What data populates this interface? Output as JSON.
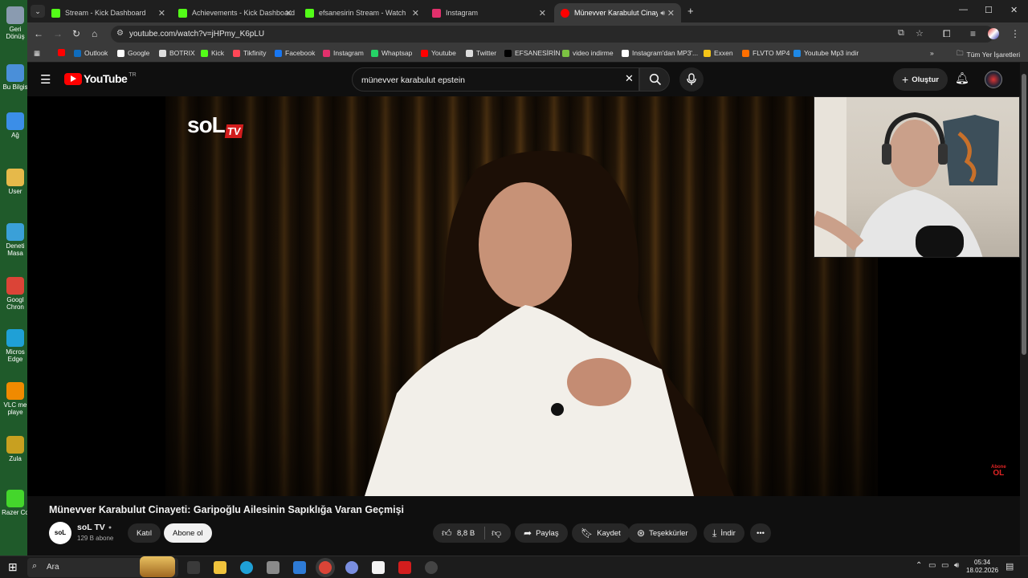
{
  "desktop": {
    "items": [
      {
        "label": "Geri\nDönüş",
        "color": "#8a9bb0"
      },
      {
        "label": "Bu Bilgis",
        "color": "#4a8fd9"
      },
      {
        "label": "Ağ",
        "color": "#3b8ee8"
      },
      {
        "label": "User",
        "color": "#e6b94a"
      },
      {
        "label": "Deneti\nMasa",
        "color": "#3aa0d8"
      },
      {
        "label": "Googl\nChron",
        "color": "#db4437"
      },
      {
        "label": "Micros\nEdge",
        "color": "#1fa0d6"
      },
      {
        "label": "VLC me\nplaye",
        "color": "#f08a00"
      },
      {
        "label": "Zula",
        "color": "#c8a020"
      },
      {
        "label": "Razer Co",
        "color": "#44d62c"
      }
    ]
  },
  "browser": {
    "tabs": [
      {
        "label": "Stream - Kick Dashboard",
        "color": "#53fc18"
      },
      {
        "label": "Achievements - Kick Dashboard",
        "color": "#53fc18"
      },
      {
        "label": "efsanesirin Stream - Watch Live",
        "color": "#53fc18"
      },
      {
        "label": "Instagram",
        "color": "#e1306c"
      },
      {
        "label": "Münevver Karabulut Cinaye",
        "color": "#ff0000"
      }
    ],
    "new_tab": "+",
    "url": "youtube.com/watch?v=jHPmy_K6pLU",
    "bookmarks": [
      {
        "label": "",
        "color": "#ff0000"
      },
      {
        "label": "Outlook",
        "color": "#0f6cbd"
      },
      {
        "label": "Google",
        "color": "#ffffff"
      },
      {
        "label": "BOTRIX",
        "color": "#dddddd"
      },
      {
        "label": "Kick",
        "color": "#53fc18"
      },
      {
        "label": "Tikfinity",
        "color": "#ff4757"
      },
      {
        "label": "Facebook",
        "color": "#1877f2"
      },
      {
        "label": "Instagram",
        "color": "#e1306c"
      },
      {
        "label": "Whaptsap",
        "color": "#25d366"
      },
      {
        "label": "Youtube",
        "color": "#ff0000"
      },
      {
        "label": "Twitter",
        "color": "#dddddd"
      },
      {
        "label": "EFSANESİRİN",
        "color": "#000000"
      },
      {
        "label": "video indirme",
        "color": "#7cc242"
      },
      {
        "label": "Instagram'dan MP3'...",
        "color": "#ffffff"
      },
      {
        "label": "Exxen",
        "color": "#f5c518"
      },
      {
        "label": "FLVTO MP4",
        "color": "#ff6f00"
      },
      {
        "label": "Youtube Mp3 indir",
        "color": "#1e88e5"
      }
    ],
    "all_bookmarks": "Tüm Yer İşaretleri"
  },
  "youtube": {
    "logo_text": "YouTube",
    "region": "TR",
    "search_query": "münevver karabulut epstein",
    "create_label": "Oluştur",
    "video": {
      "channel_watermark": "soL",
      "channel_watermark_tv": "TV",
      "subscribe_corner_top": "Abone",
      "subscribe_corner_bottom": "OL"
    },
    "title": "Münevver Karabulut Cinayeti: Garipoğlu Ailesinin Sapıklığa Varan Geçmişi",
    "channel": {
      "name": "soL TV",
      "avatar_text": "soL",
      "subscribers": "129 B abone",
      "join_label": "Katıl",
      "subscribe_label": "Abone ol"
    },
    "actions": {
      "likes": "8,8 B",
      "share": "Paylaş",
      "save": "Kaydet",
      "thanks": "Teşekkürler",
      "download": "İndir"
    }
  },
  "taskbar": {
    "search_label": "Ara",
    "time": "05:34",
    "date": "18.02.2026"
  }
}
